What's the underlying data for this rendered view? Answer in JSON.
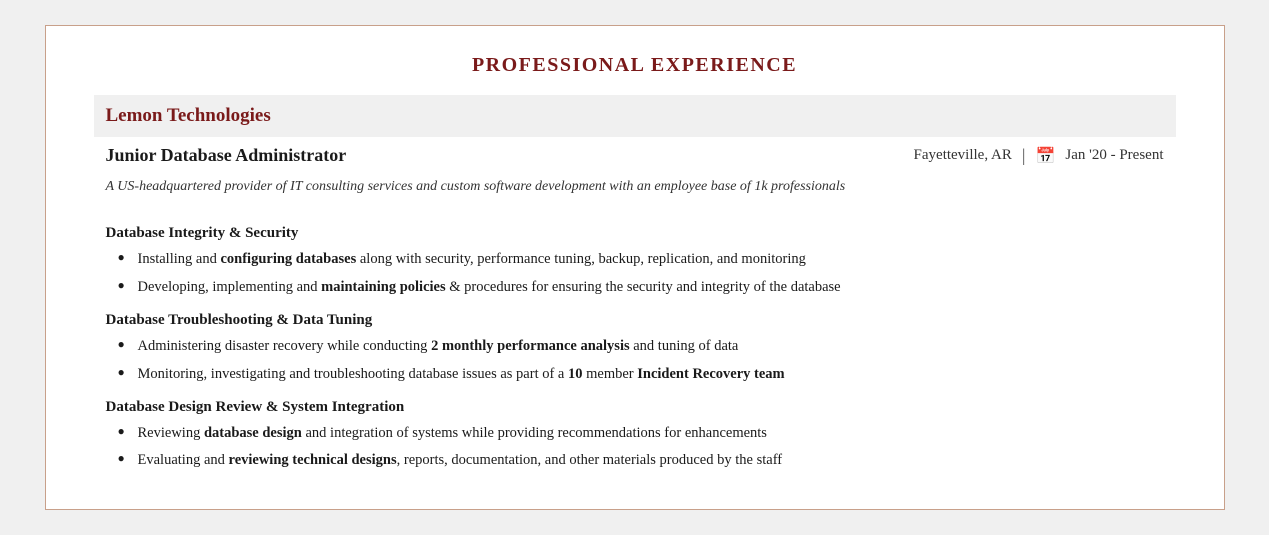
{
  "section": {
    "title": "PROFESSIONAL EXPERIENCE"
  },
  "company": {
    "name": "Lemon Technologies",
    "location": "Fayetteville, AR",
    "date_range": "Jan '20 -  Present",
    "description": "A US-headquartered provider of IT consulting services and custom software development with an employee base of 1k professionals"
  },
  "job": {
    "title": "Junior Database Administrator"
  },
  "skills": [
    {
      "title": "Database Integrity & Security",
      "bullets": [
        {
          "parts": [
            {
              "text": "Installing and ",
              "bold": false
            },
            {
              "text": "configuring databases",
              "bold": true
            },
            {
              "text": " along with security, performance tuning, backup, replication, and monitoring",
              "bold": false
            }
          ]
        },
        {
          "parts": [
            {
              "text": "Developing, implementing and ",
              "bold": false
            },
            {
              "text": "maintaining policies",
              "bold": true
            },
            {
              "text": " & procedures for ensuring the security and integrity of the database",
              "bold": false
            }
          ]
        }
      ]
    },
    {
      "title": "Database Troubleshooting & Data Tuning",
      "bullets": [
        {
          "parts": [
            {
              "text": "Administering disaster recovery while conducting ",
              "bold": false
            },
            {
              "text": "2 monthly performance analysis",
              "bold": true
            },
            {
              "text": " and tuning of data",
              "bold": false
            }
          ]
        },
        {
          "parts": [
            {
              "text": "Monitoring, investigating and troubleshooting database issues as part of a ",
              "bold": false
            },
            {
              "text": "10",
              "bold": true
            },
            {
              "text": " member ",
              "bold": false
            },
            {
              "text": "Incident Recovery team",
              "bold": true
            }
          ]
        }
      ]
    },
    {
      "title": "Database Design Review & System Integration",
      "bullets": [
        {
          "parts": [
            {
              "text": "Reviewing ",
              "bold": false
            },
            {
              "text": "database design",
              "bold": true
            },
            {
              "text": " and integration of systems while providing recommendations for enhancements",
              "bold": false
            }
          ]
        },
        {
          "parts": [
            {
              "text": "Evaluating and ",
              "bold": false
            },
            {
              "text": "reviewing technical designs",
              "bold": true
            },
            {
              "text": ", reports, documentation, and other materials produced by the staff",
              "bold": false
            }
          ]
        }
      ]
    }
  ]
}
